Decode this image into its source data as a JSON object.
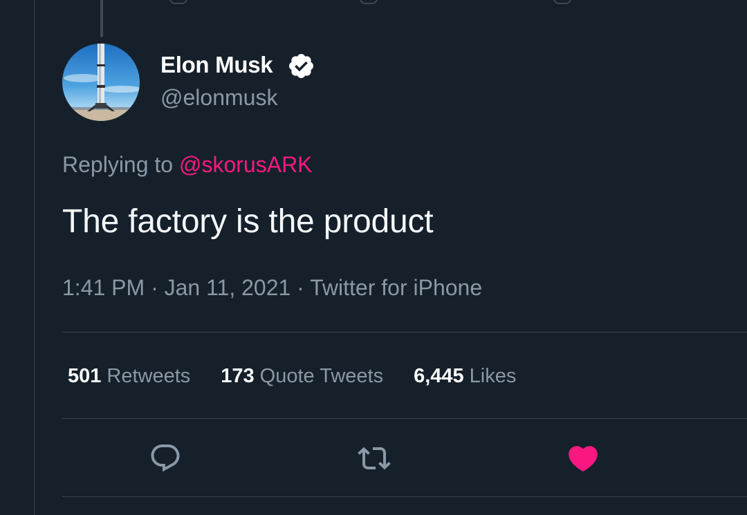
{
  "author": {
    "display_name": "Elon Musk",
    "handle": "@elonmusk",
    "verified": true,
    "avatar": "rocket-launch-photo"
  },
  "reply": {
    "prefix": "Replying to ",
    "mention": "@skorusARK"
  },
  "tweet": {
    "text": "The factory is the product"
  },
  "meta": {
    "text": "1:41 PM · Jan 11, 2021 · Twitter for iPhone"
  },
  "stats": [
    {
      "count": "501",
      "label": "Retweets"
    },
    {
      "count": "173",
      "label": "Quote Tweets"
    },
    {
      "count": "6,445",
      "label": "Likes"
    }
  ],
  "actions": [
    {
      "name": "reply",
      "icon": "speech-bubble-icon"
    },
    {
      "name": "retweet",
      "icon": "retweet-icon"
    },
    {
      "name": "like",
      "icon": "heart-icon",
      "active": true
    }
  ],
  "colors": {
    "background": "#15202b",
    "mention": "#f91880",
    "like_active": "#f91880",
    "secondary_text": "#8b98a5",
    "divider": "#38444d"
  }
}
